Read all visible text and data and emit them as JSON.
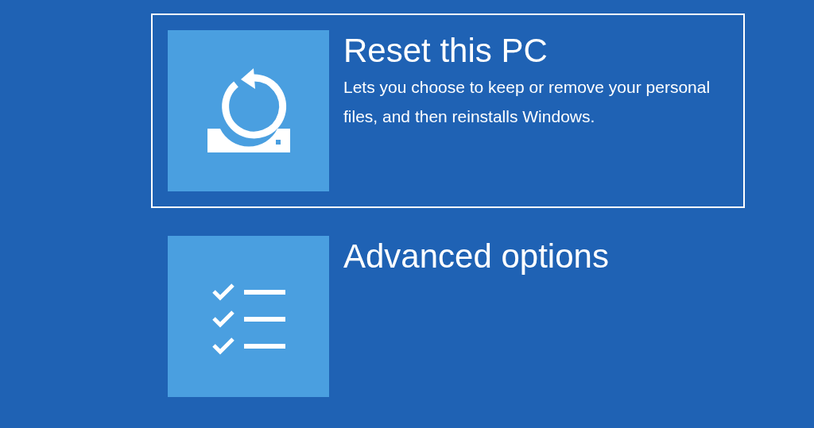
{
  "options": [
    {
      "kind": "reset",
      "title": "Reset this PC",
      "description": "Lets you choose to keep or remove your personal files, and then reinstalls Windows.",
      "selected": true
    },
    {
      "kind": "advanced",
      "title": "Advanced options",
      "selected": false
    }
  ]
}
